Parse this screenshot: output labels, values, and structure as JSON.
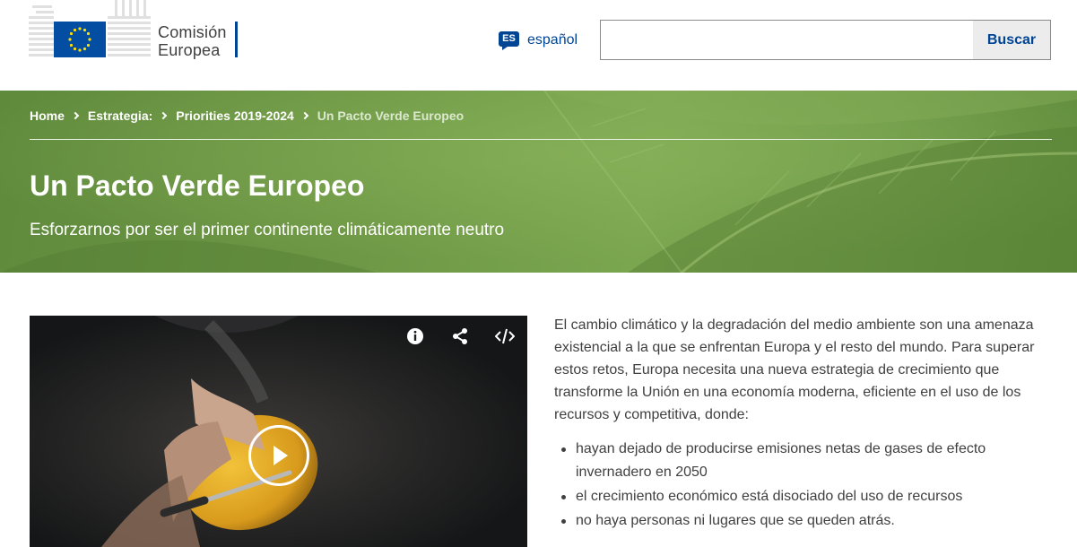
{
  "header": {
    "logo_line1": "Comisión",
    "logo_line2": "Europea",
    "lang_code": "ES",
    "lang_label": "español",
    "search_value": "",
    "search_button": "Buscar"
  },
  "breadcrumb": [
    {
      "label": "Home"
    },
    {
      "label": "Estrategia:"
    },
    {
      "label": "Priorities 2019-2024"
    },
    {
      "label": "Un Pacto Verde Europeo"
    }
  ],
  "hero": {
    "title": "Un Pacto Verde Europeo",
    "subtitle": "Esforzarnos por ser el primer continente climáticamente neutro"
  },
  "video": {
    "controls": [
      "info-icon",
      "share-icon",
      "embed-code-icon",
      "play-icon"
    ]
  },
  "content": {
    "intro": "El cambio climático y la degradación del medio ambiente son una amenaza existencial a la que se enfrentan Europa y el resto del mundo. Para superar estos retos, Europa necesita una nueva estrategia de crecimiento que transforme la Unión en una economía moderna, eficiente en el uso de los recursos y competitiva, donde:",
    "bullets": [
      "hayan dejado de producirse emisiones netas de gases de efecto invernadero en 2050",
      "el crecimiento económico está disociado del uso de recursos",
      "no haya personas ni lugares que se queden atrás."
    ]
  },
  "colors": {
    "brand_blue": "#004494",
    "eu_flag_blue": "#034ea2",
    "eu_star_yellow": "#ffdd00",
    "hero_green": "#6e9845"
  }
}
